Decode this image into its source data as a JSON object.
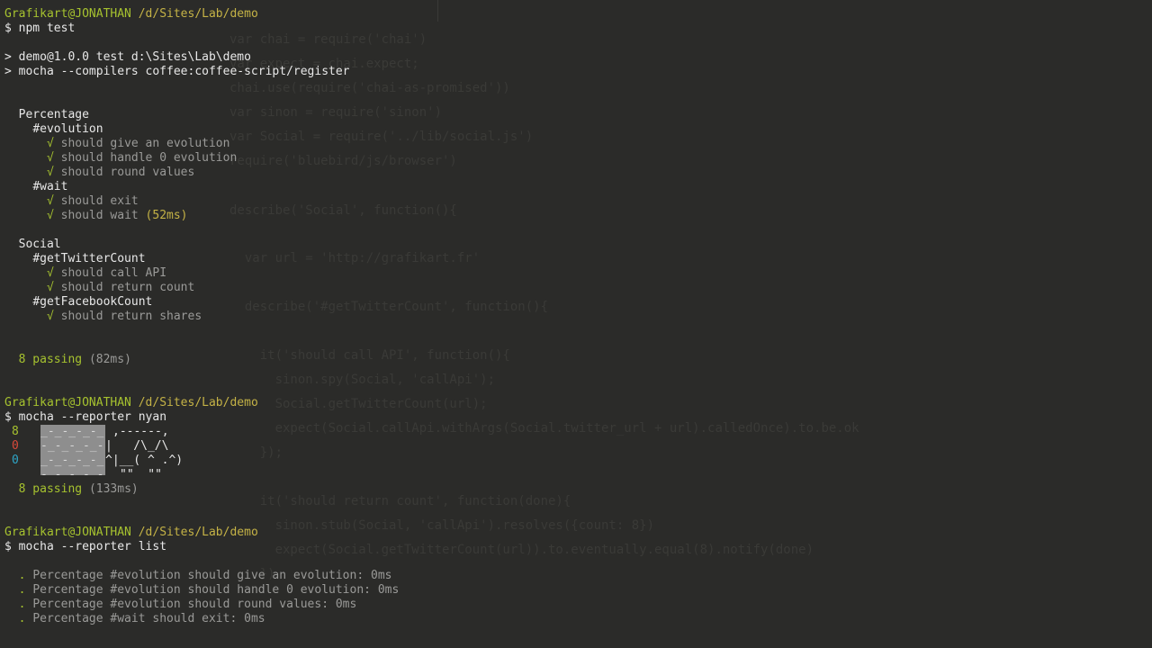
{
  "prompt": {
    "user": "Grafikart@JONATHAN",
    "path": "/d/Sites/Lab/demo",
    "symbol": "$"
  },
  "block1": {
    "command": "npm test",
    "script_lines": [
      "> demo@1.0.0 test d:\\Sites\\Lab\\demo",
      "> mocha --compilers coffee:coffee-script/register"
    ],
    "suites": [
      {
        "name": "Percentage",
        "groups": [
          {
            "name": "#evolution",
            "tests": [
              {
                "text": "should give an evolution",
                "time": ""
              },
              {
                "text": "should handle 0 evolution",
                "time": ""
              },
              {
                "text": "should round values",
                "time": ""
              }
            ]
          },
          {
            "name": "#wait",
            "tests": [
              {
                "text": "should exit",
                "time": ""
              },
              {
                "text": "should wait",
                "time": "(52ms)"
              }
            ]
          }
        ]
      },
      {
        "name": "Social",
        "groups": [
          {
            "name": "#getTwitterCount",
            "tests": [
              {
                "text": "should call API",
                "time": ""
              },
              {
                "text": "should return count",
                "time": ""
              }
            ]
          },
          {
            "name": "#getFacebookCount",
            "tests": [
              {
                "text": "should return shares",
                "time": ""
              }
            ]
          }
        ]
      }
    ],
    "check": "√",
    "passing": "8 passing",
    "passing_time": "(82ms)"
  },
  "block2": {
    "command": "mocha --reporter nyan",
    "counts": {
      "pass": "8",
      "fail": "0",
      "pending": "0"
    },
    "rainbow": [
      "_-_-_-_-_",
      "-_-_-_-_-",
      "_-_-_-_-_",
      "-_-_-_-_-"
    ],
    "cat": [
      ",------,",
      "|   /\\_/\\",
      "^|__( ^ .^)",
      "\"\"  \"\""
    ],
    "colors": {
      "pass": "#a6c22f",
      "fail": "#d9493a",
      "pending": "#2fa6c8"
    },
    "passing": "8 passing",
    "passing_time": "(133ms)"
  },
  "block3": {
    "command": "mocha --reporter list",
    "items": [
      {
        "bullet": ".",
        "text": "Percentage #evolution should give an evolution: 0ms"
      },
      {
        "bullet": ".",
        "text": "Percentage #evolution should handle 0 evolution: 0ms"
      },
      {
        "bullet": ".",
        "text": "Percentage #evolution should round values: 0ms"
      },
      {
        "bullet": ".",
        "text": "Percentage #wait should exit: 0ms"
      }
    ]
  },
  "background_code": [
    "var chai = require('chai')",
    "var expect = chai.expect;",
    "chai.use(require('chai-as-promised'))",
    "var sinon = require('sinon')",
    "var Social = require('../lib/social.js')",
    "require('bluebird/js/browser')",
    "describe('Social', function(){",
    "  var url = 'http://grafikart.fr'",
    "  describe('#getTwitterCount', function(){",
    "    it('should call API', function(){",
    "      sinon.spy(Social, 'callApi');",
    "      Social.getTwitterCount(url);",
    "      expect(Social.callApi.withArgs(Social.twitter_url + url).calledOnce).to.be.ok",
    "    });",
    "    it('should return count', function(done){",
    "      sinon.stub(Social, 'callApi').resolves({count: 8})",
    "      expect(Social.getTwitterCount(url)).to.eventually.equal(8).notify(done)",
    "    })"
  ]
}
